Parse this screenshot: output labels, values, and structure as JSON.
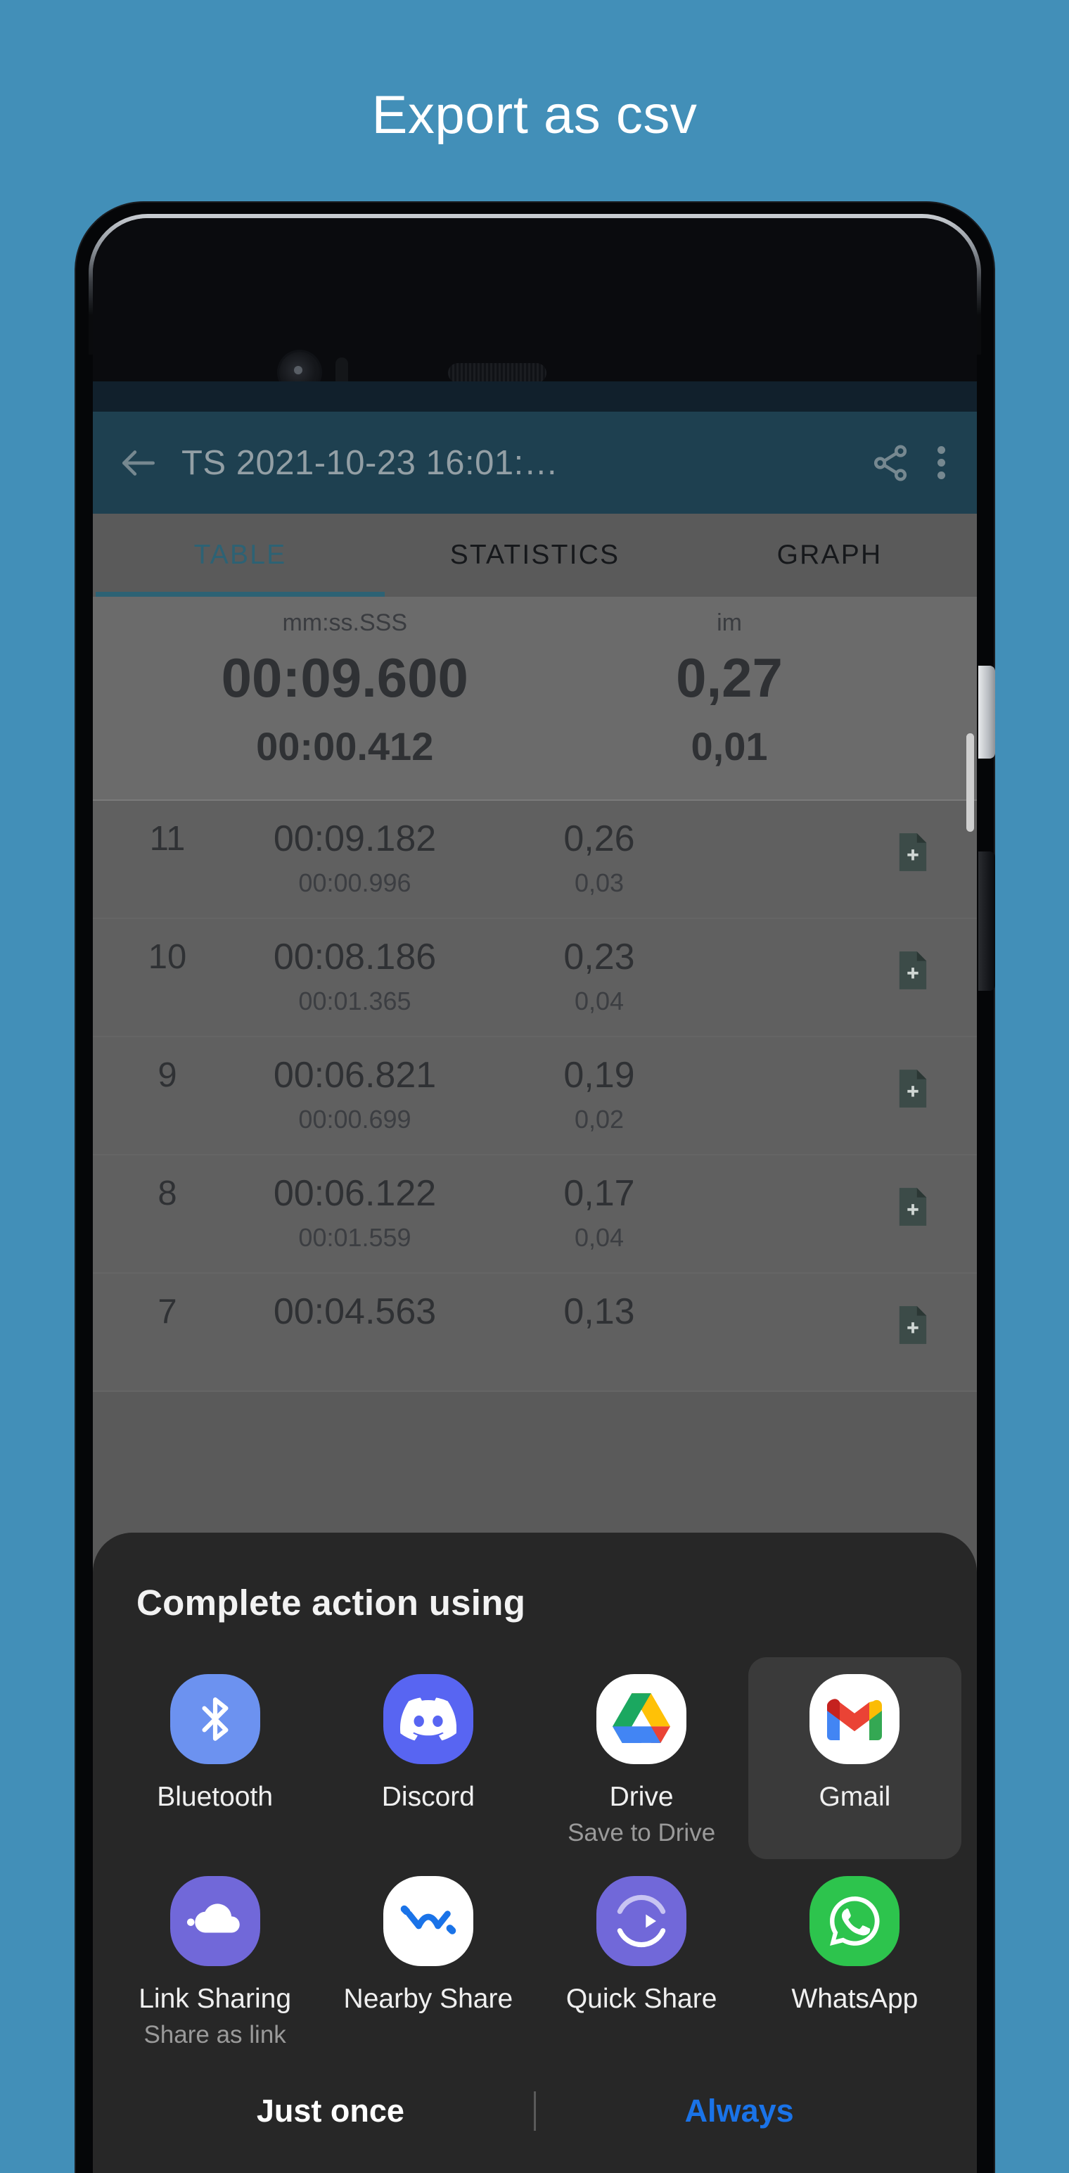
{
  "banner": {
    "title": "Export as csv"
  },
  "app": {
    "toolbar": {
      "back_icon": "arrow-left-icon",
      "title": "TS 2021-10-23 16:01:…",
      "share_icon": "share-icon",
      "overflow_icon": "more-vertical-icon"
    },
    "tabs": [
      {
        "label": "TABLE",
        "active": true
      },
      {
        "label": "STATISTICS",
        "active": false
      },
      {
        "label": "GRAPH",
        "active": false
      }
    ],
    "summary": {
      "header_time": "mm:ss.SSS",
      "header_value": "im",
      "time_total": "00:09.600",
      "value_total": "0,27",
      "time_sub": "00:00.412",
      "value_sub": "0,01"
    },
    "table": {
      "rows": [
        {
          "index": "11",
          "time": "00:09.182",
          "time_delta": "00:00.996",
          "value": "0,26",
          "value_delta": "0,03",
          "note_icon": "note-add-icon"
        },
        {
          "index": "10",
          "time": "00:08.186",
          "time_delta": "00:01.365",
          "value": "0,23",
          "value_delta": "0,04",
          "note_icon": "note-add-icon"
        },
        {
          "index": "9",
          "time": "00:06.821",
          "time_delta": "00:00.699",
          "value": "0,19",
          "value_delta": "0,02",
          "note_icon": "note-add-icon"
        },
        {
          "index": "8",
          "time": "00:06.122",
          "time_delta": "00:01.559",
          "value": "0,17",
          "value_delta": "0,04",
          "note_icon": "note-add-icon"
        },
        {
          "index": "7",
          "time": "00:04.563",
          "time_delta": "",
          "value": "0,13",
          "value_delta": "",
          "note_icon": "note-add-icon"
        }
      ]
    }
  },
  "share_sheet": {
    "title": "Complete action using",
    "apps": [
      {
        "label": "Bluetooth",
        "subtitle": "",
        "icon": "bluetooth-icon",
        "selected": false
      },
      {
        "label": "Discord",
        "subtitle": "",
        "icon": "discord-icon",
        "selected": false
      },
      {
        "label": "Drive",
        "subtitle": "Save to Drive",
        "icon": "google-drive-icon",
        "selected": false
      },
      {
        "label": "Gmail",
        "subtitle": "",
        "icon": "gmail-icon",
        "selected": true
      },
      {
        "label": "Link Sharing",
        "subtitle": "Share as link",
        "icon": "link-sharing-icon",
        "selected": false
      },
      {
        "label": "Nearby Share",
        "subtitle": "",
        "icon": "nearby-share-icon",
        "selected": false
      },
      {
        "label": "Quick Share",
        "subtitle": "",
        "icon": "quick-share-icon",
        "selected": false
      },
      {
        "label": "WhatsApp",
        "subtitle": "",
        "icon": "whatsapp-icon",
        "selected": false
      }
    ],
    "just_once_label": "Just once",
    "always_label": "Always"
  },
  "colors": {
    "background": "#428fb8",
    "toolbar": "#1e4050",
    "tab_active": "#2d6274",
    "sheet": "#272727",
    "always_accent": "#1a73e8"
  }
}
